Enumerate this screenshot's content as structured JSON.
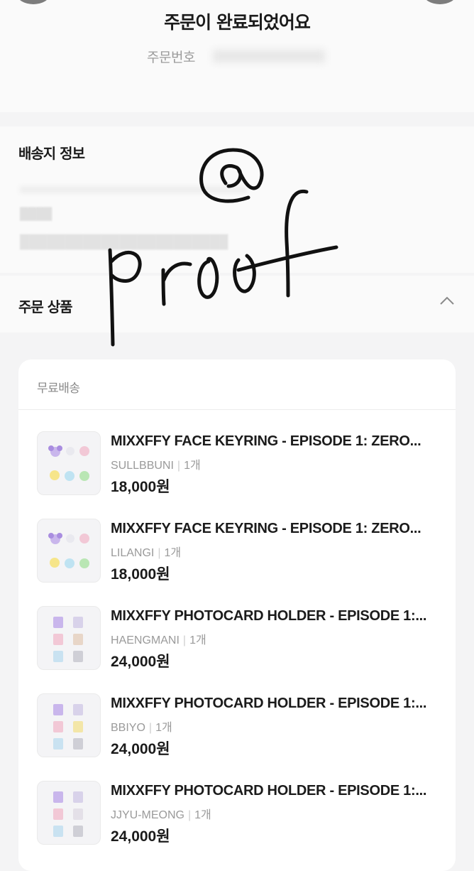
{
  "header": {
    "title": "주문이 완료되었어요",
    "order_number_label": "주문번호"
  },
  "shipping": {
    "title": "배송지 정보"
  },
  "order_items": {
    "title": "주문 상품",
    "shipping_label": "무료배송",
    "items": [
      {
        "name": "MIXXFFY FACE KEYRING - EPISODE 1: ZERO...",
        "option": "SULLBBUNI",
        "qty": "1개",
        "price": "18,000원",
        "thumb_icon": "keyring-thumbnail"
      },
      {
        "name": "MIXXFFY FACE KEYRING - EPISODE 1: ZERO...",
        "option": "LILANGI",
        "qty": "1개",
        "price": "18,000원",
        "thumb_icon": "keyring-thumbnail"
      },
      {
        "name": "MIXXFFY PHOTOCARD HOLDER - EPISODE 1:...",
        "option": "HAENGMANI",
        "qty": "1개",
        "price": "24,000원",
        "thumb_icon": "photocard-holder-thumbnail"
      },
      {
        "name": "MIXXFFY PHOTOCARD HOLDER - EPISODE 1:...",
        "option": "BBIYO",
        "qty": "1개",
        "price": "24,000원",
        "thumb_icon": "photocard-holder-thumbnail"
      },
      {
        "name": "MIXXFFY PHOTOCARD HOLDER - EPISODE 1:...",
        "option": "JJYU-MEONG",
        "qty": "1개",
        "price": "24,000원",
        "thumb_icon": "photocard-holder-thumbnail"
      }
    ]
  },
  "overlay": {
    "handwriting_text": "@ proof",
    "ink_color": "#111111"
  }
}
